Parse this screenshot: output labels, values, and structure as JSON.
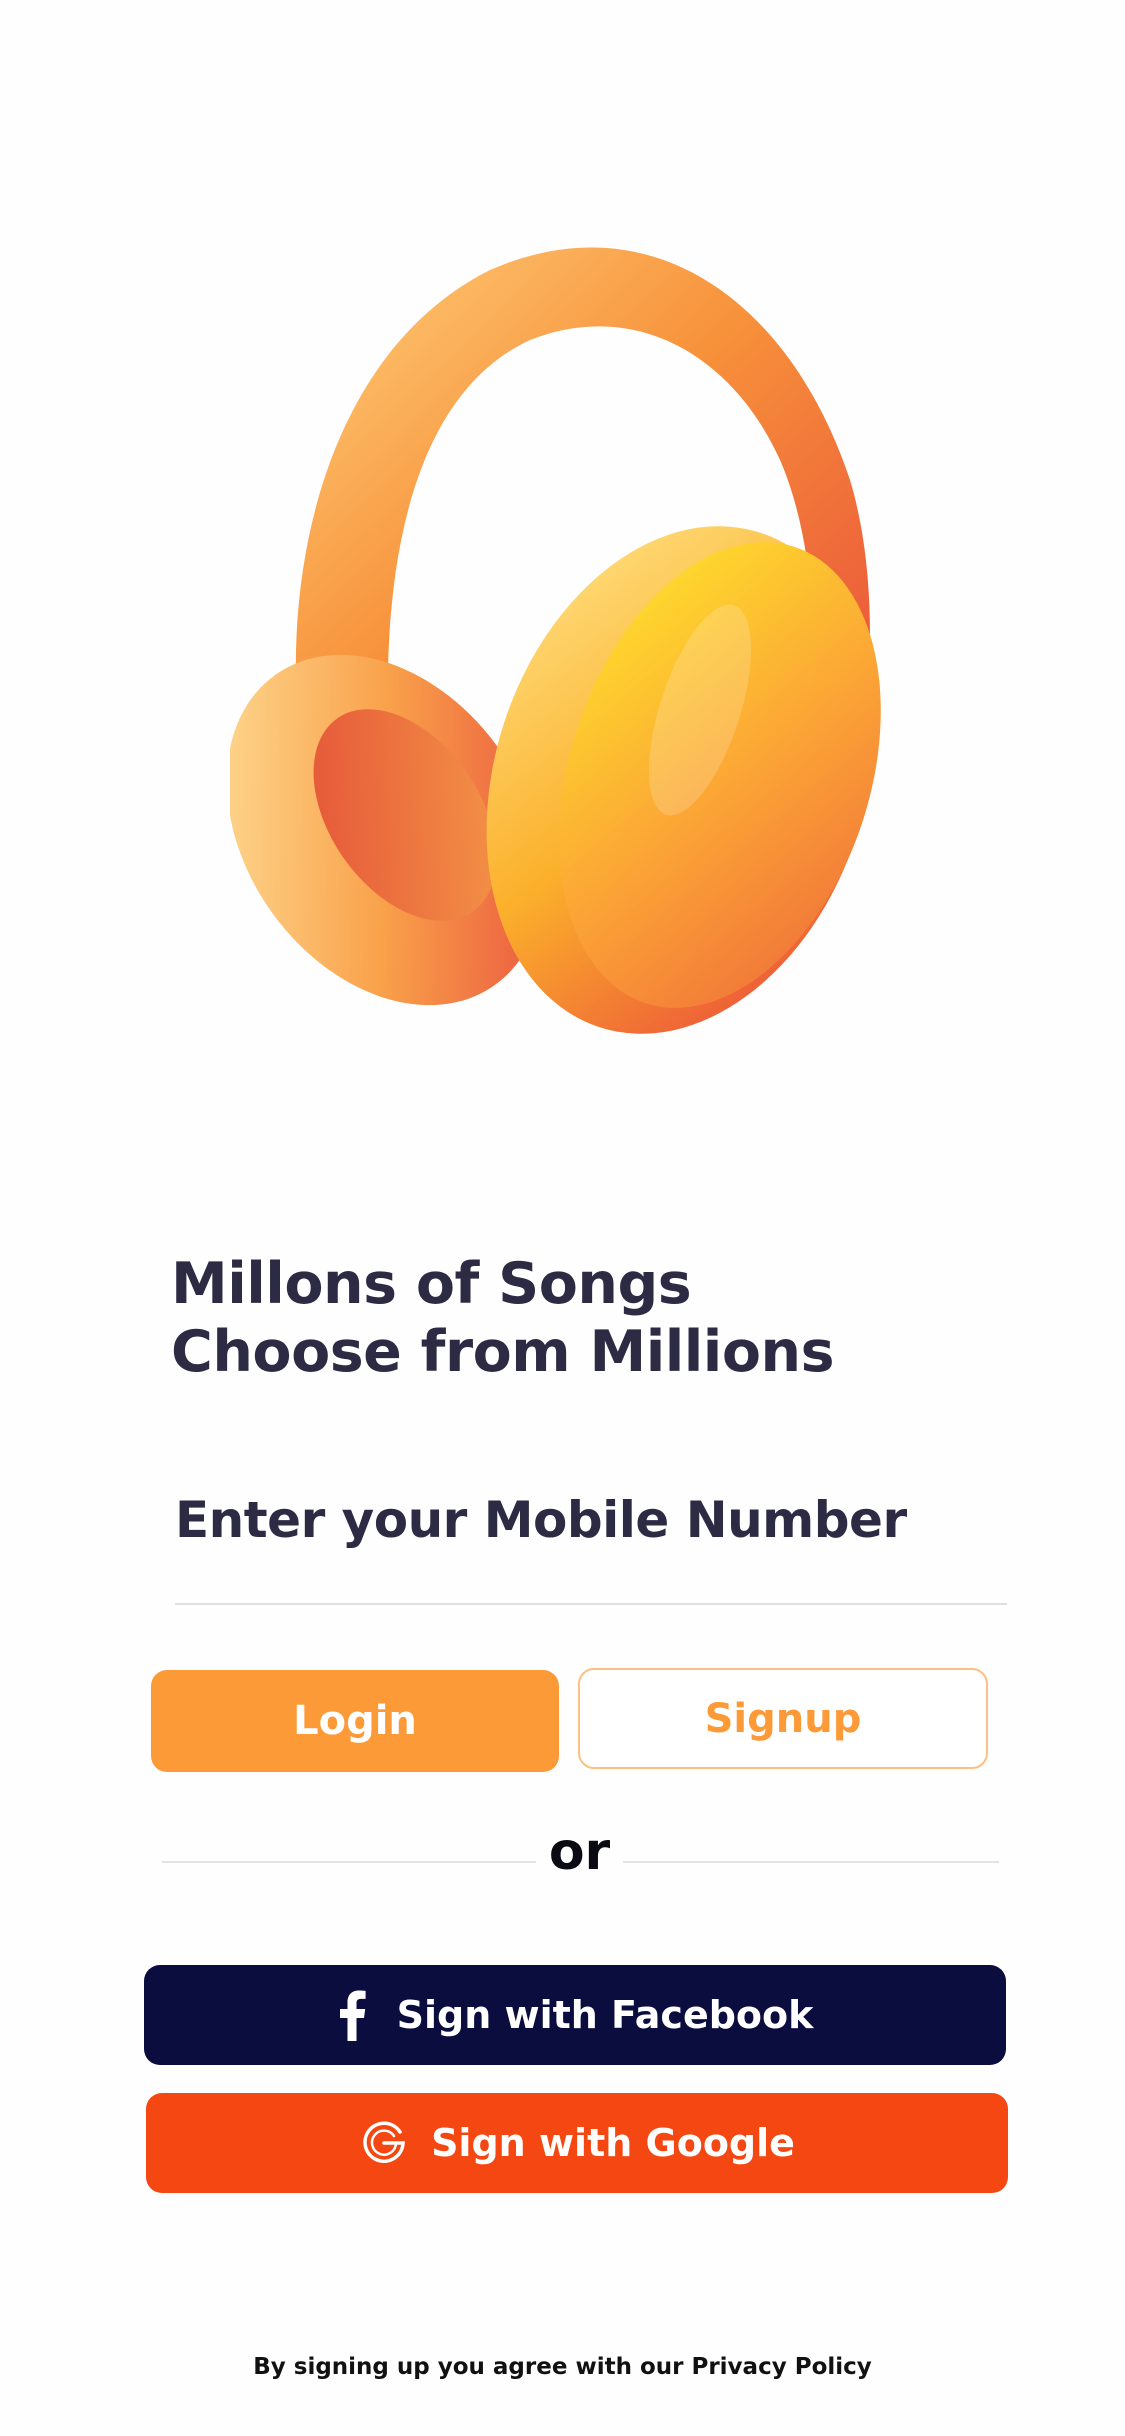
{
  "headline": {
    "line1": "Millons of Songs",
    "line2": "Choose from Millions"
  },
  "mobile": {
    "placeholder": "Enter your Mobile Number"
  },
  "auth": {
    "login_label": "Login",
    "signup_label": "Signup",
    "divider_label": "or"
  },
  "social": {
    "facebook_label": "Sign with Facebook",
    "google_label": "Sign with Google"
  },
  "footer": {
    "policy_text": "By signing up you agree with our Privacy Policy"
  },
  "icons": {
    "hero": "headphones-illustration",
    "facebook": "facebook-icon",
    "google": "google-icon"
  },
  "colors": {
    "accent": "#fd9a38",
    "facebook": "#0b0d3f",
    "google": "#f44711",
    "heading": "#2d2b44"
  }
}
